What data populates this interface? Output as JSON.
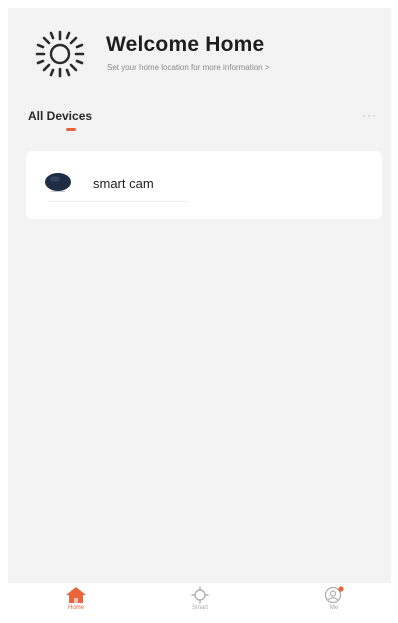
{
  "header": {
    "title": "Welcome Home",
    "subtitle": "Set your home location for more information >",
    "icon": "sun-icon"
  },
  "section": {
    "tab_label": "All Devices",
    "more_label": "···"
  },
  "devices": [
    {
      "name": "smart cam",
      "icon": "camera-icon"
    }
  ],
  "tabbar": {
    "items": [
      {
        "label": "Home",
        "icon": "home-icon",
        "active": true
      },
      {
        "label": "Smart",
        "icon": "smart-icon",
        "active": false
      },
      {
        "label": "Me",
        "icon": "profile-icon",
        "active": false
      }
    ]
  },
  "colors": {
    "accent": "#e9653b",
    "background": "#f3f3f3",
    "card": "#ffffff"
  }
}
